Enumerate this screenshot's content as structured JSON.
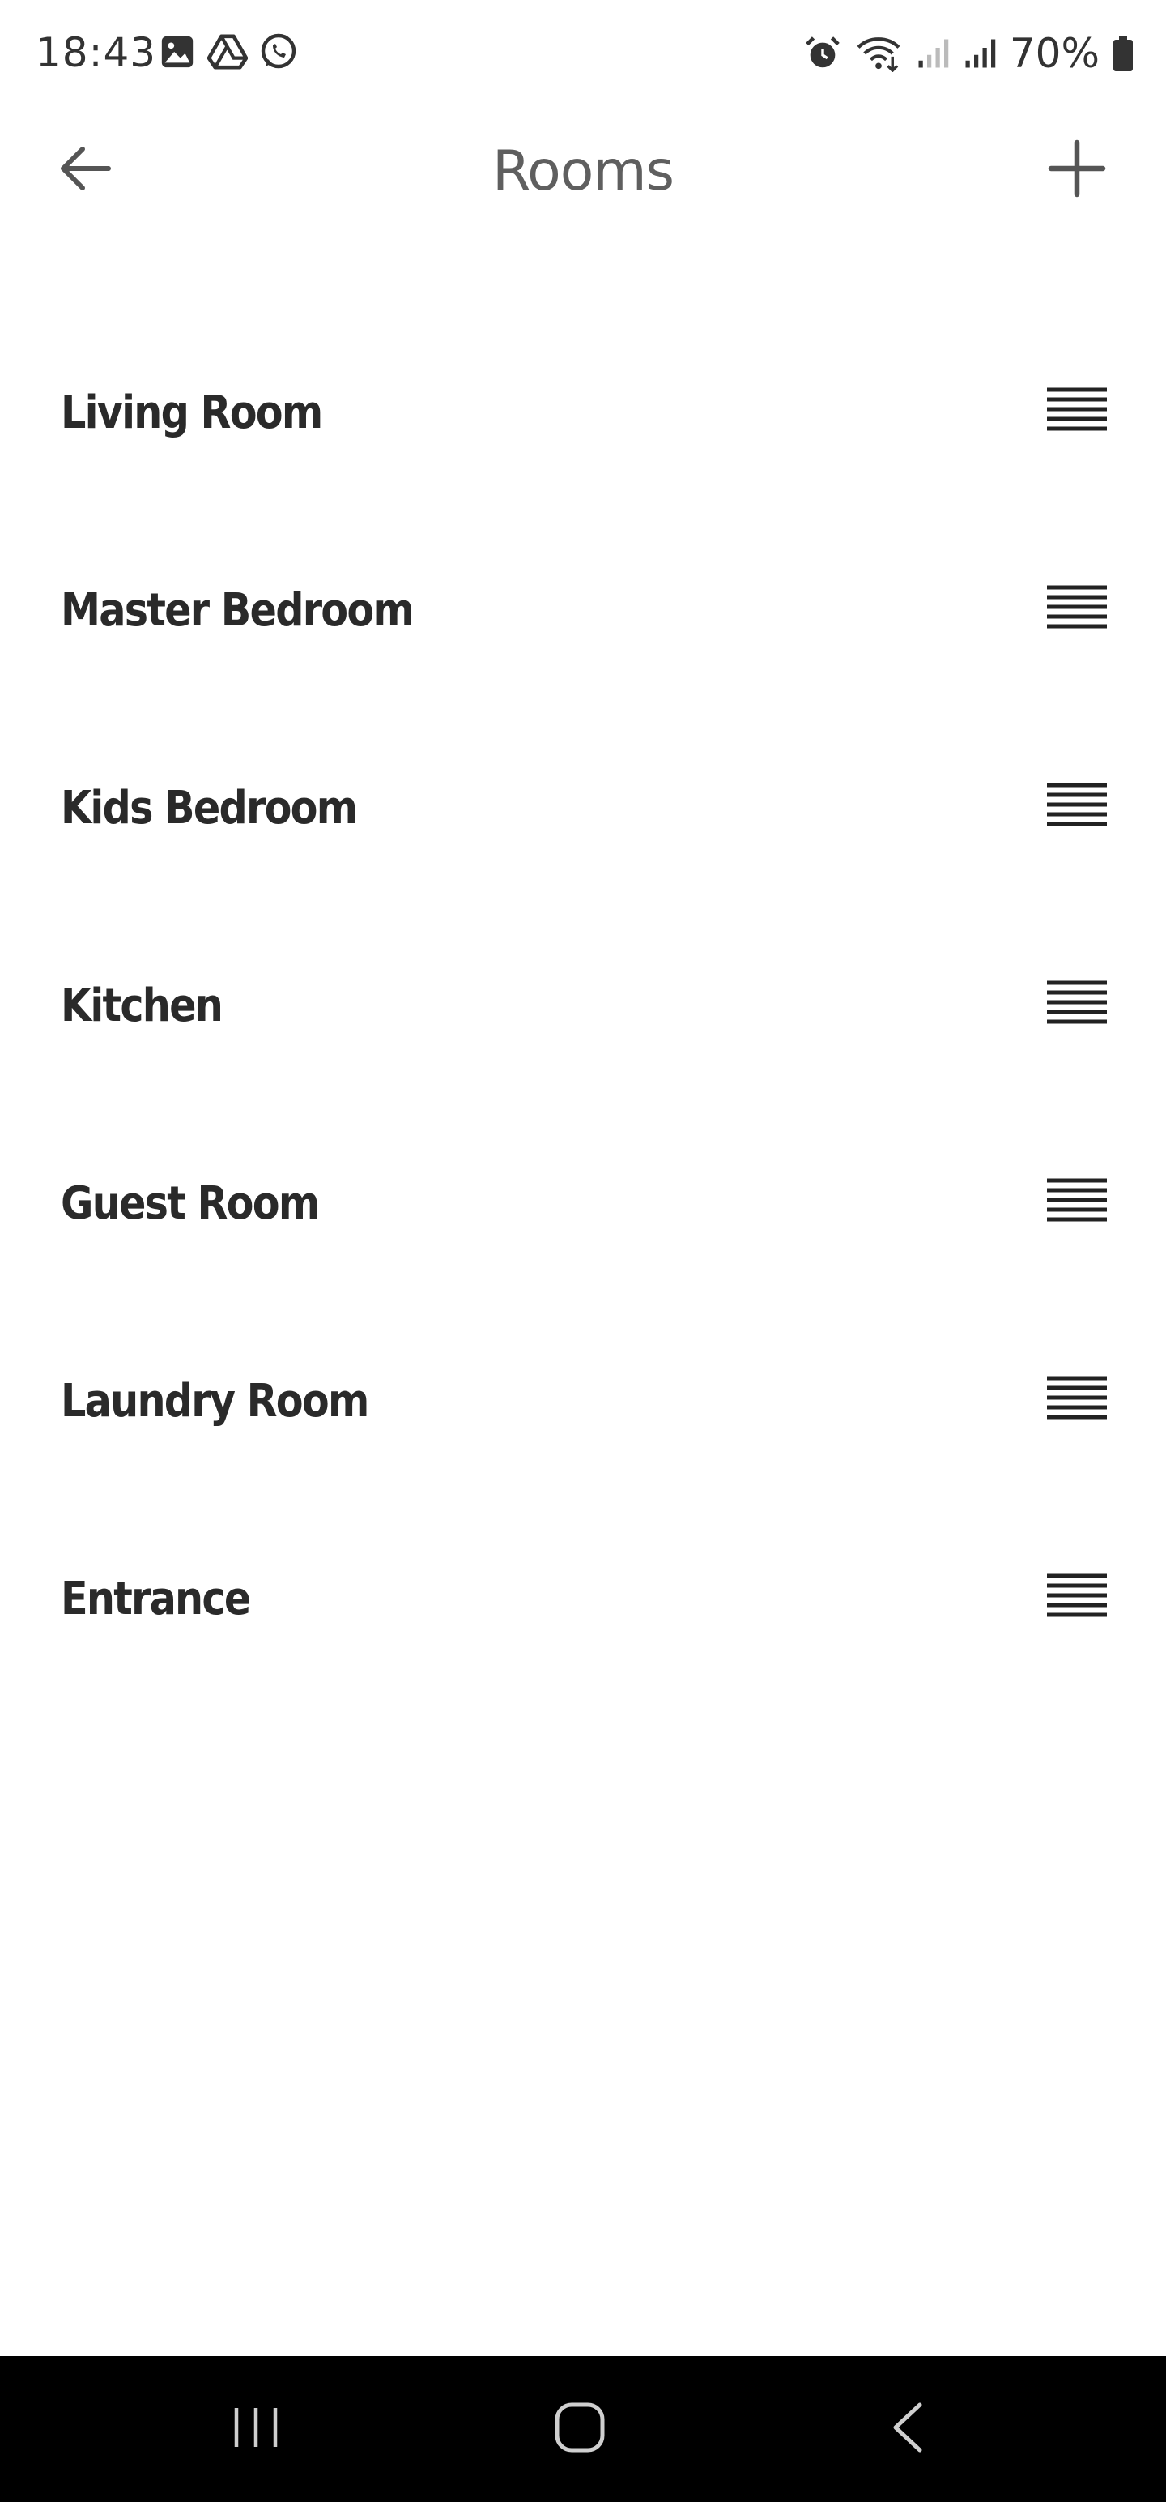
{
  "status_bar": {
    "time": "18:43",
    "left_icons": [
      "gallery-icon",
      "drive-icon",
      "whatsapp-icon"
    ],
    "right_icons": [
      "alarm-icon",
      "wifi-icon",
      "signal-weak-icon",
      "signal-icon",
      "battery-icon"
    ],
    "battery": "70%"
  },
  "header": {
    "title": "Rooms",
    "back_icon": "arrow-left-icon",
    "add_icon": "plus-icon"
  },
  "rooms": [
    {
      "name": "Living Room"
    },
    {
      "name": "Master Bedroom"
    },
    {
      "name": "Kids Bedroom"
    },
    {
      "name": "Kitchen"
    },
    {
      "name": "Guest Room"
    },
    {
      "name": "Laundry Room"
    },
    {
      "name": "Entrance"
    }
  ],
  "nav_bar": {
    "recents_icon": "recents-icon",
    "home_icon": "home-icon",
    "back_icon": "back-chevron-icon"
  },
  "colors": {
    "title": "#5f5f5f",
    "room_text": "#2a2a2a",
    "icon": "#555555",
    "nav_bg": "#000000"
  }
}
